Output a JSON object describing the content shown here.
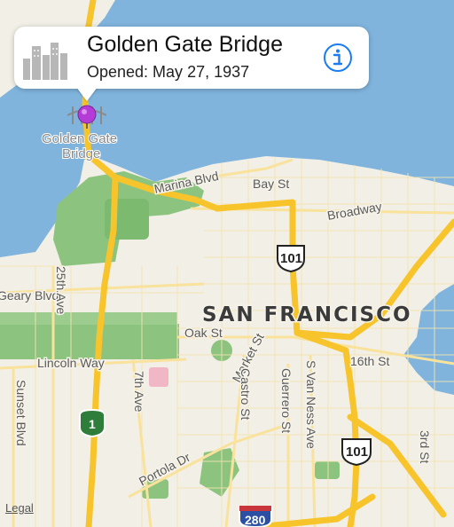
{
  "callout": {
    "title": "Golden Gate Bridge",
    "subtitle": "Opened: May 27, 1937",
    "info_icon": "info-circle-icon",
    "thumbnail_icon": "city-skyline-icon"
  },
  "pin": {
    "color": "#b43bd6",
    "poi_label_line1": "Golden Gate",
    "poi_label_line2": "Bridge"
  },
  "city_label": "San Francisco",
  "streets": {
    "marina": "Marina Blvd",
    "bay": "Bay St",
    "broadway": "Broadway",
    "geary": "Geary Blvd",
    "ave25": "25th Ave",
    "oak": "Oak St",
    "market": "Market St",
    "castro": "Castro St",
    "guerrero": "Guerrero St",
    "van_ness": "S Van Ness Ave",
    "st16": "16th St",
    "lincoln": "Lincoln Way",
    "ave7": "7th Ave",
    "sunset": "Sunset Blvd",
    "portola": "Portola Dr",
    "st3": "3rd St"
  },
  "shields": {
    "us101_top": "101",
    "us101_bottom": "101",
    "ca1": "1",
    "i280": "280"
  },
  "legal": "Legal",
  "colors": {
    "water": "#7fb3dc",
    "land": "#f2efe6",
    "park": "#86c47b",
    "highway": "#f7c530",
    "road": "#fbe7a6",
    "pin": "#b43bd6"
  }
}
